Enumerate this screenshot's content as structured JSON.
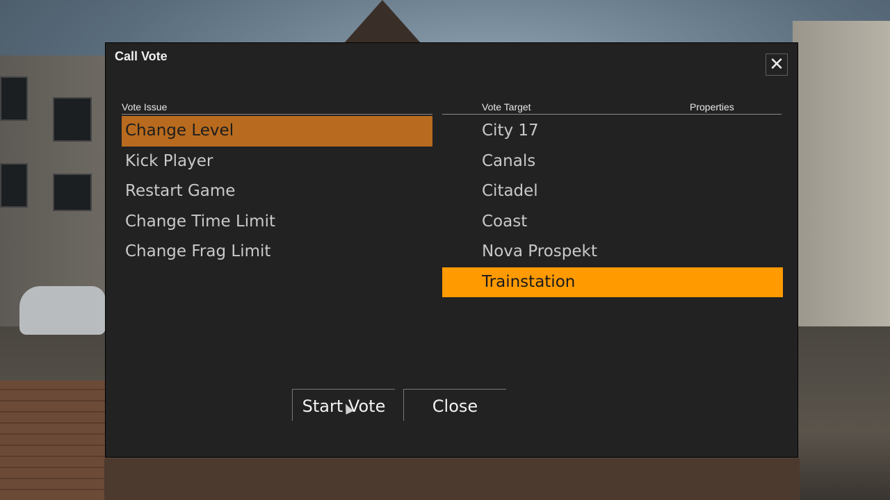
{
  "dialog": {
    "title": "Call Vote",
    "close_glyph": "✕"
  },
  "headers": {
    "vote_issue": "Vote Issue",
    "vote_target": "Vote Target",
    "properties": "Properties"
  },
  "vote_issues": [
    {
      "label": "Change Level",
      "selected": true
    },
    {
      "label": "Kick Player",
      "selected": false
    },
    {
      "label": "Restart Game",
      "selected": false
    },
    {
      "label": "Change Time Limit",
      "selected": false
    },
    {
      "label": "Change Frag Limit",
      "selected": false
    }
  ],
  "vote_targets": [
    {
      "label": "City 17",
      "selected": false
    },
    {
      "label": "Canals",
      "selected": false
    },
    {
      "label": "Citadel",
      "selected": false
    },
    {
      "label": "Coast",
      "selected": false
    },
    {
      "label": "Nova Prospekt",
      "selected": false
    },
    {
      "label": "Trainstation",
      "selected": true
    }
  ],
  "buttons": {
    "start_vote": "Start Vote",
    "close": "Close"
  },
  "colors": {
    "issue_selected": "#b86b1e",
    "target_selected": "#ff9a00",
    "panel": "#222222"
  }
}
